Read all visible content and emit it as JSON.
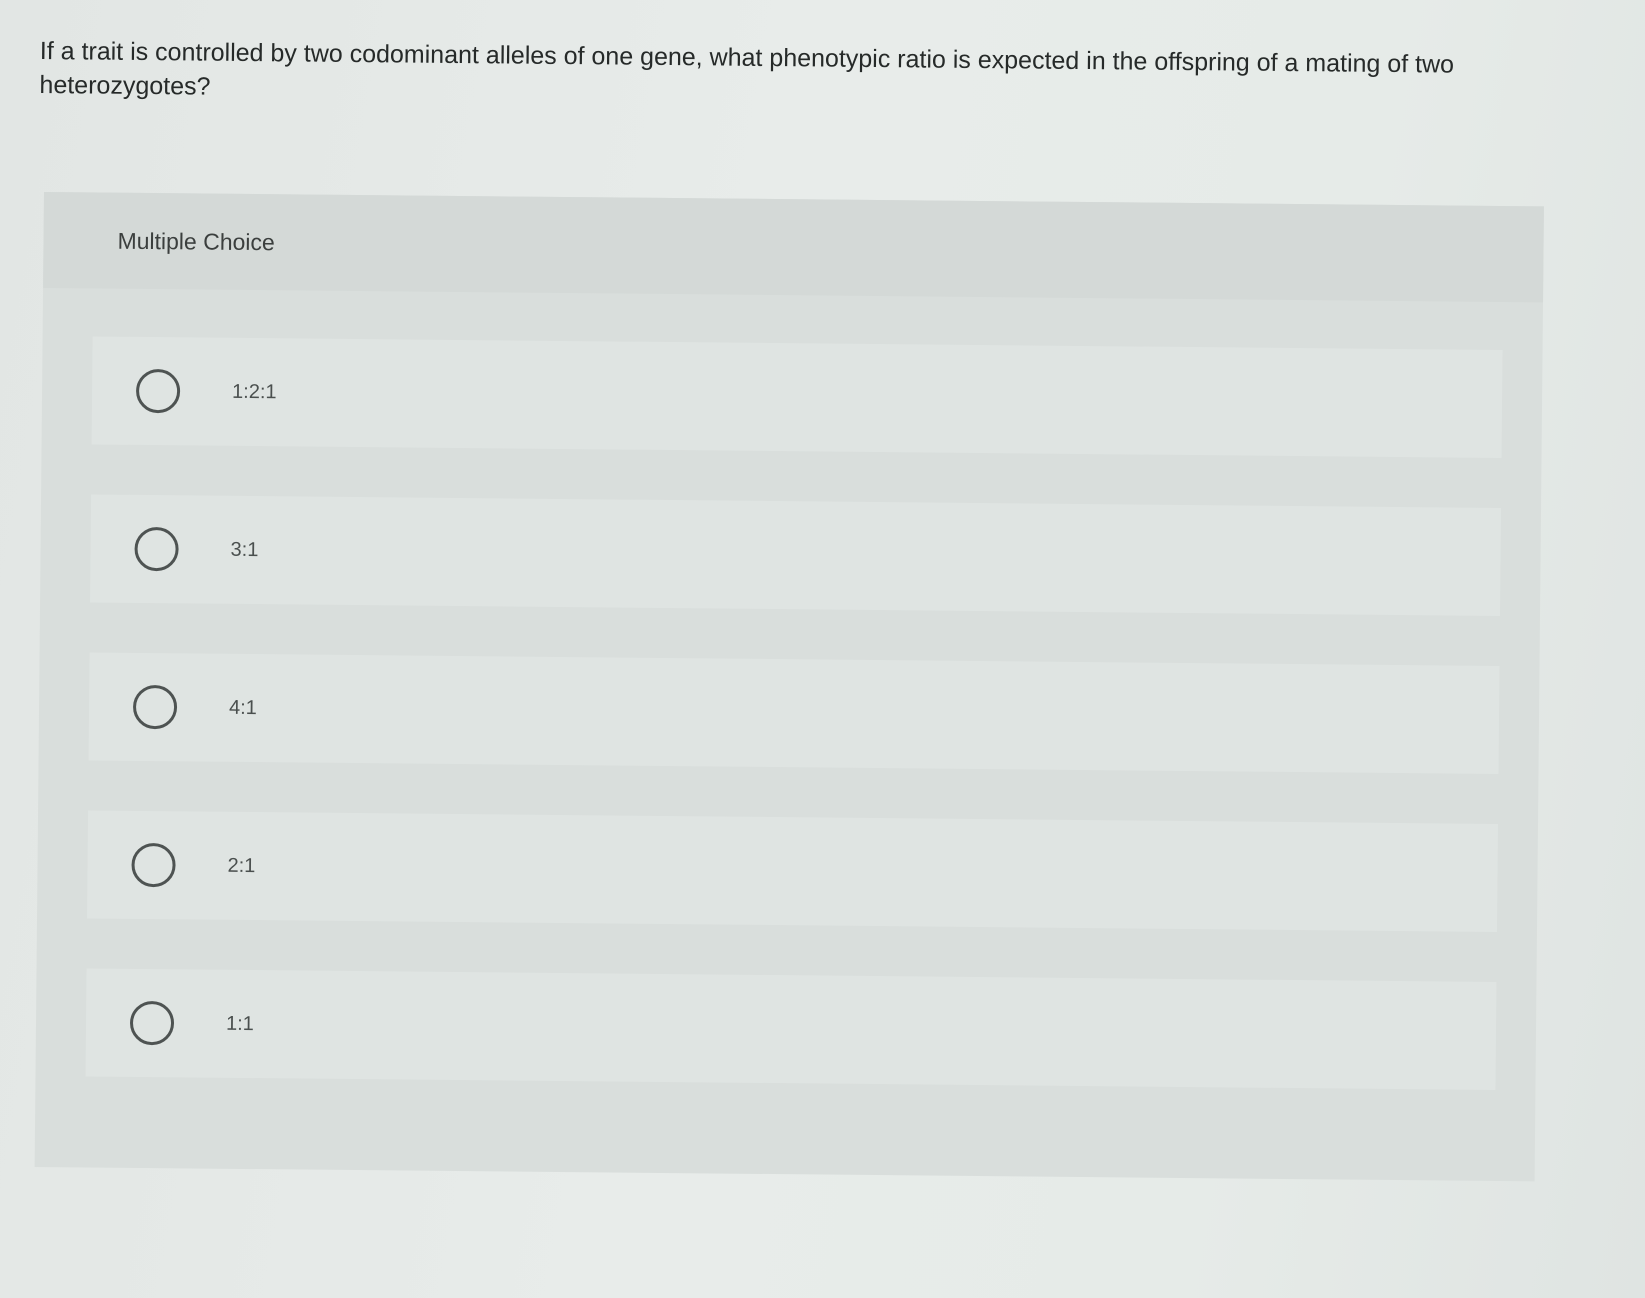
{
  "question": {
    "text": "If a trait is controlled by two codominant alleles of one gene, what phenotypic ratio is expected in the offspring of a mating of two heterozygotes?"
  },
  "multiple_choice": {
    "title": "Multiple Choice",
    "options": [
      {
        "label": "1:2:1"
      },
      {
        "label": "3:1"
      },
      {
        "label": "4:1"
      },
      {
        "label": "2:1"
      },
      {
        "label": "1:1"
      }
    ]
  },
  "colors": {
    "background": "#e6ebe8",
    "panel": "#d9dedc",
    "option_row": "#dfe4e2",
    "text": "#262a29"
  }
}
